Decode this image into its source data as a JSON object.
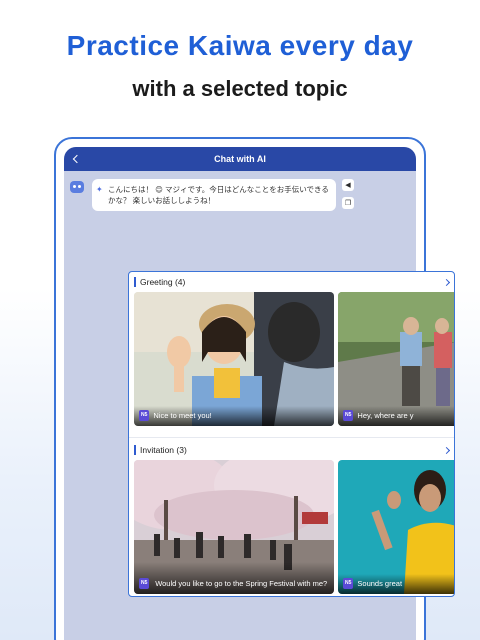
{
  "headline": "Practice Kaiwa every day",
  "subline": "with a selected topic",
  "chat": {
    "title": "Chat with AI",
    "message": "こんにちは！ 😊 マジィです。今日はどんなことをお手伝いできるかな？ 楽しいお話ししようね！"
  },
  "sections": [
    {
      "title": "Greeting (4)",
      "cards": [
        {
          "level": "N5",
          "caption": "Nice to meet you!"
        },
        {
          "level": "N5",
          "caption": "Hey, where are y"
        }
      ]
    },
    {
      "title": "Invitation (3)",
      "cards": [
        {
          "level": "N5",
          "caption": "Would you like to go to the Spring Festival with me?"
        },
        {
          "level": "N5",
          "caption": "Sounds great"
        }
      ]
    }
  ],
  "icons": {
    "back": "chevron-left-icon",
    "bot": "bot-avatar-icon",
    "sparkle": "sparkle-icon",
    "speaker": "speaker-icon",
    "copy": "copy-icon",
    "section_arrow": "chevron-right-icon"
  },
  "colors": {
    "accent": "#1f5fd6",
    "topbar": "#2948a6",
    "badge": "#5a4ad6"
  }
}
